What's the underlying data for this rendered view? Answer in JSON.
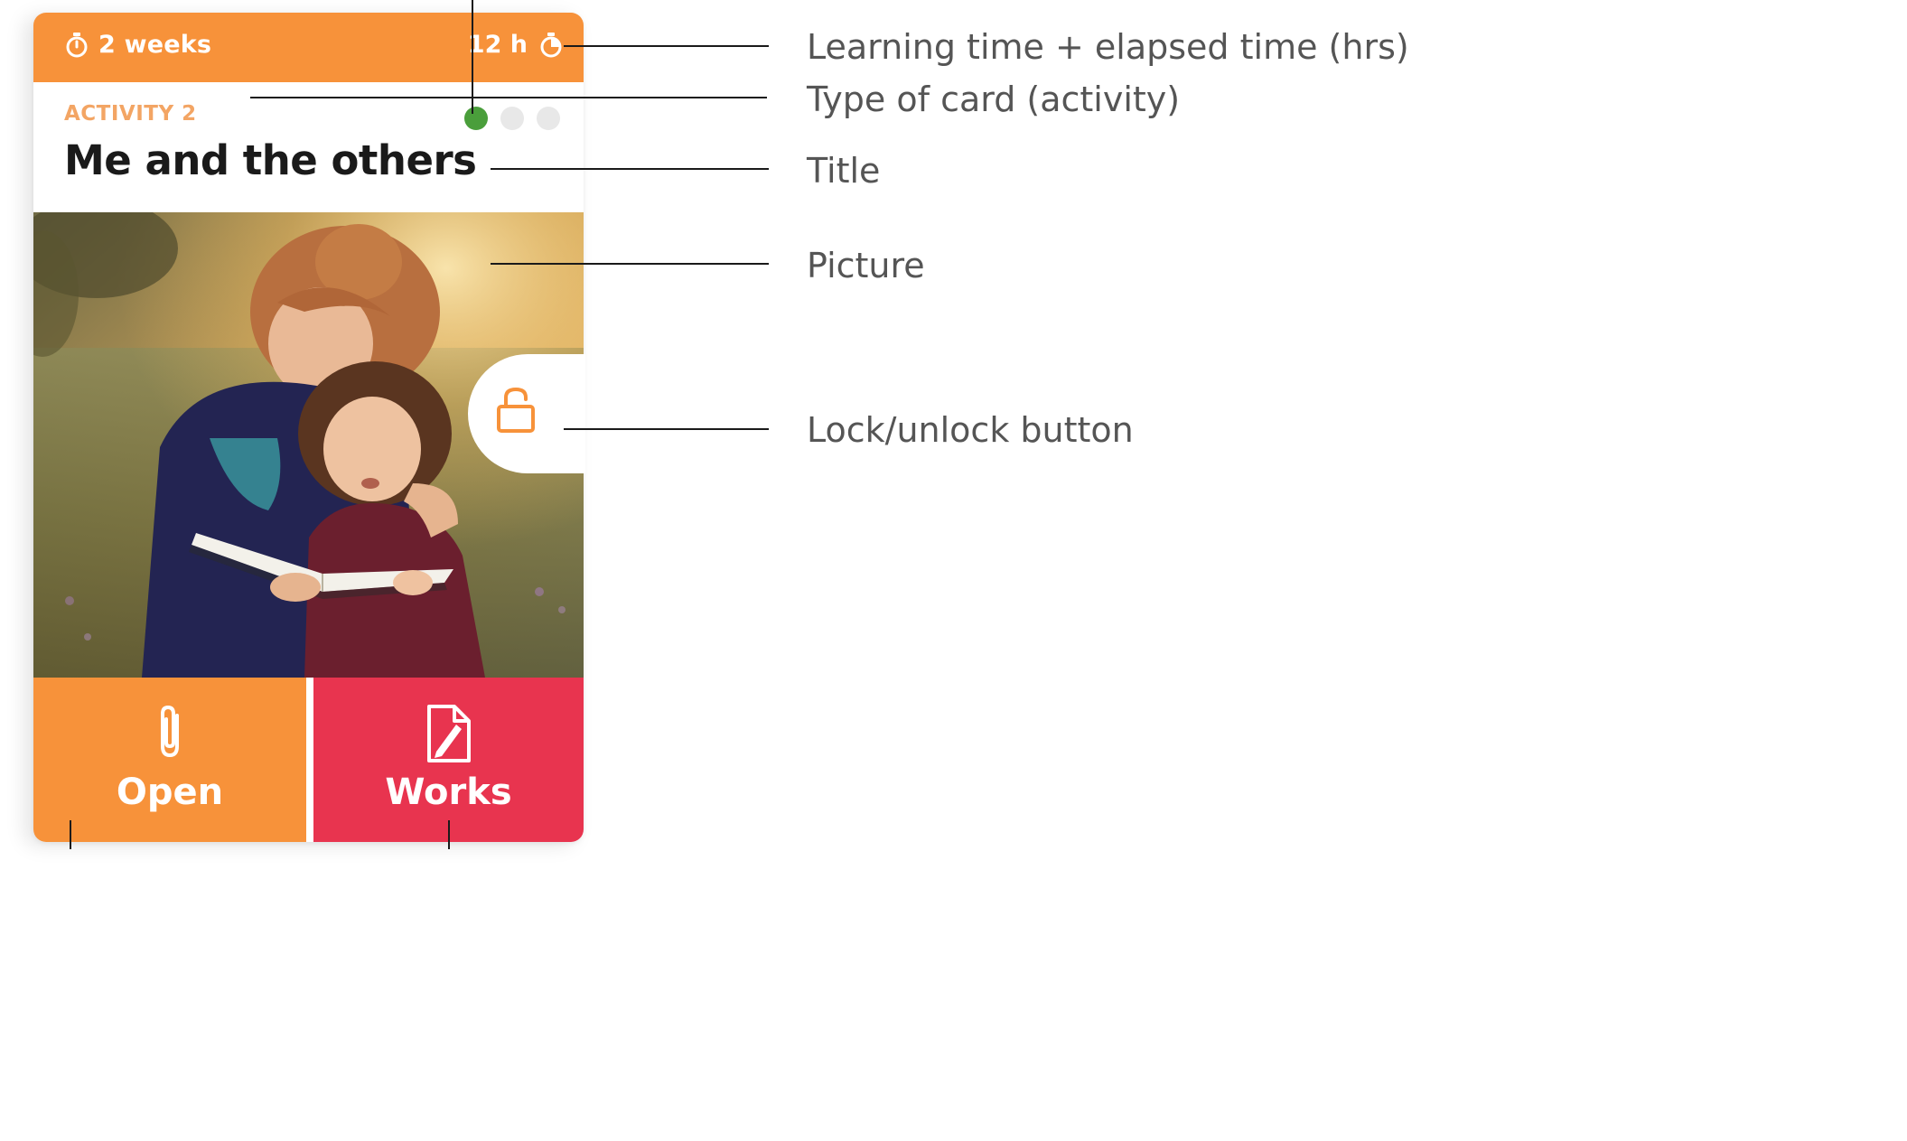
{
  "colors": {
    "accent": "#f7923a",
    "accent_light": "#f3a564",
    "works": "#e8344f",
    "active_dot": "#4a9e3b",
    "label_text": "#555555"
  },
  "card": {
    "duration_label": "2 weeks",
    "elapsed_label": "12 h",
    "type_label": "ACTIVITY 2",
    "title": "Me and the others",
    "progress_dots": [
      {
        "state": "active"
      },
      {
        "state": "inactive"
      },
      {
        "state": "inactive"
      }
    ],
    "picture_icon": "photo-two-girls-reading",
    "lock_icon": "lock-open-icon",
    "open_button": {
      "label": "Open",
      "icon": "paperclip-icon"
    },
    "works_button": {
      "label": "Works",
      "icon": "document-pencil-icon"
    }
  },
  "annotations": [
    {
      "id": "time",
      "text": "Learning time + elapsed time (hrs)"
    },
    {
      "id": "type",
      "text": "Type of card (activity)"
    },
    {
      "id": "title",
      "text": "Title"
    },
    {
      "id": "picture",
      "text": "Picture"
    },
    {
      "id": "lock",
      "text": "Lock/unlock button"
    }
  ]
}
